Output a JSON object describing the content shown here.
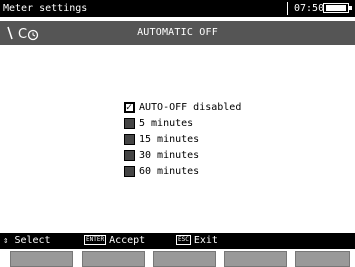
{
  "statusbar": {
    "title": "Meter settings",
    "time": "07:50"
  },
  "header": {
    "heading": "AUTOMATIC OFF",
    "icon_text": "Ő"
  },
  "options": [
    {
      "label": "AUTO-OFF disabled",
      "checked": true
    },
    {
      "label": "5 minutes",
      "checked": false
    },
    {
      "label": "15 minutes",
      "checked": false
    },
    {
      "label": "30 minutes",
      "checked": false
    },
    {
      "label": "60 minutes",
      "checked": false
    }
  ],
  "footer": {
    "select_label": "Select",
    "enter_key": "ENTER",
    "accept_label": "Accept",
    "esc_key": "ESC",
    "exit_label": "Exit"
  }
}
